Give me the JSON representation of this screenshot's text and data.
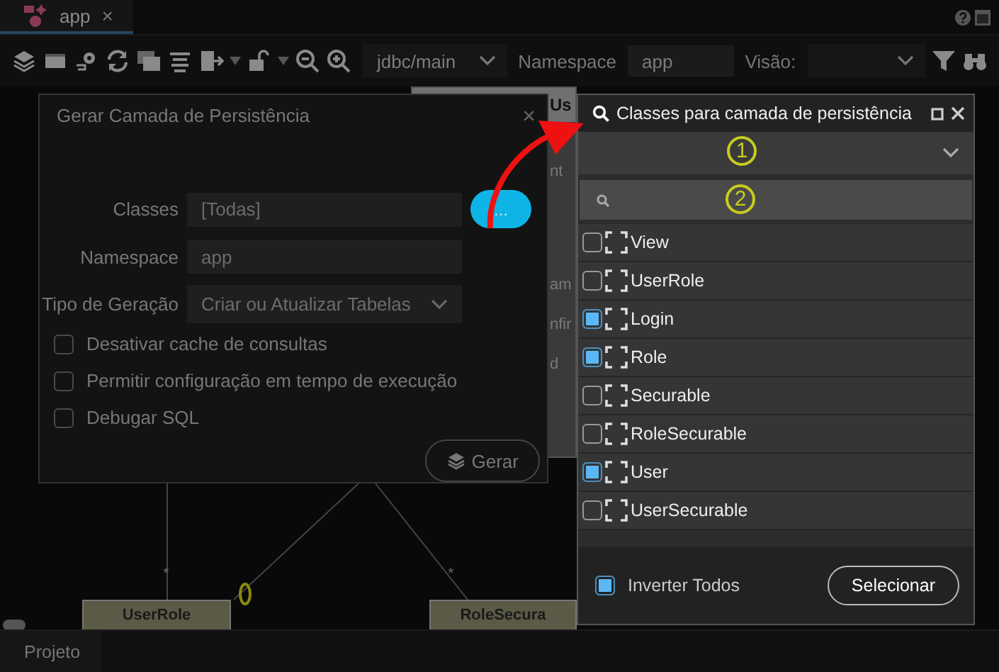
{
  "tab": {
    "title": "app",
    "close": "×"
  },
  "toolbar": {
    "datasource": "jdbc/main",
    "namespace_label": "Namespace",
    "namespace": "app",
    "view_label": "Visão:"
  },
  "diagram": {
    "fragment": {
      "header": "Us",
      "fields": [
        "nt",
        "am",
        "nfir",
        "d"
      ]
    },
    "entities": [
      {
        "name": "UserRole"
      },
      {
        "name": "RoleSecura"
      }
    ],
    "multiplicities": [
      "*",
      "*"
    ]
  },
  "dialog": {
    "title": "Gerar Camada de Persistência",
    "close": "×",
    "fields": [
      {
        "label": "Classes",
        "value": "[Todas]",
        "kind": "browse",
        "button": "..."
      },
      {
        "label": "Namespace",
        "value": "app",
        "kind": "text"
      },
      {
        "label": "Tipo de Geração",
        "value": "Criar ou Atualizar Tabelas",
        "kind": "select"
      }
    ],
    "options": [
      {
        "label": "Desativar cache de consultas",
        "checked": false
      },
      {
        "label": "Permitir configuração em tempo de execução",
        "checked": false
      },
      {
        "label": "Debugar SQL",
        "checked": false
      }
    ],
    "submit": "Gerar"
  },
  "panel": {
    "title": "Classes para camada de persistência",
    "filter_marker": "1",
    "search_marker": "2",
    "classes": [
      {
        "name": "View",
        "checked": false
      },
      {
        "name": "UserRole",
        "checked": false
      },
      {
        "name": "Login",
        "checked": true
      },
      {
        "name": "Role",
        "checked": true
      },
      {
        "name": "Securable",
        "checked": false
      },
      {
        "name": "RoleSecurable",
        "checked": false
      },
      {
        "name": "User",
        "checked": true
      },
      {
        "name": "UserSecurable",
        "checked": false
      }
    ],
    "invert": {
      "label": "Inverter Todos",
      "checked": true
    },
    "select_button": "Selecionar"
  },
  "bottom_tab": "Projeto"
}
